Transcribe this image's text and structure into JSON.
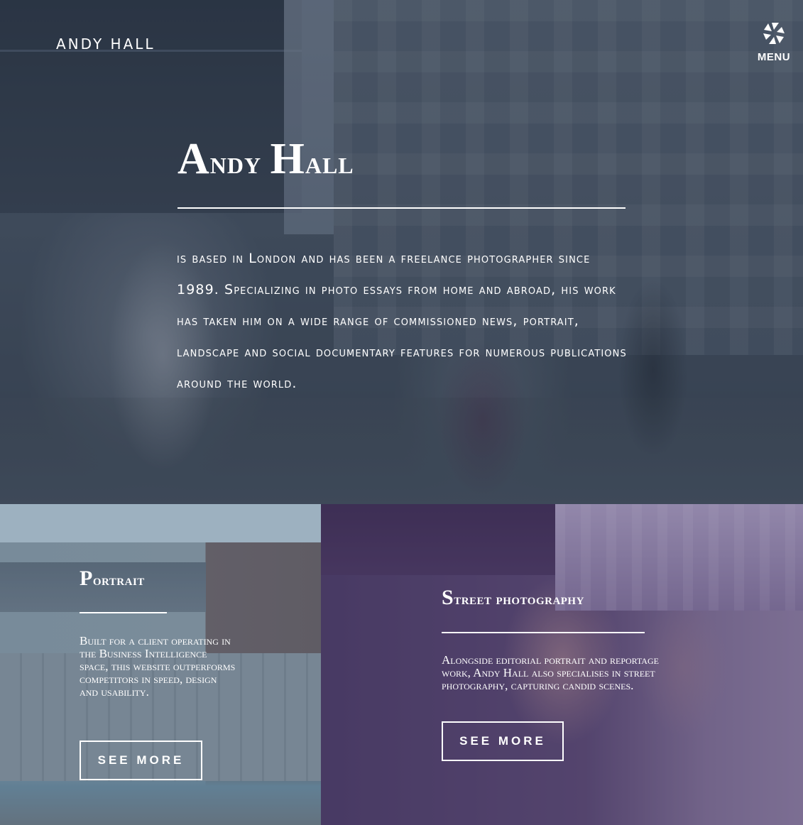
{
  "header": {
    "brand": "ANDY HALL",
    "menu_label": "MENU",
    "menu_icon": "aperture-icon"
  },
  "hero": {
    "title_initial_1": "A",
    "title_rest_1": "ndy ",
    "title_initial_2": "H",
    "title_rest_2": "all",
    "description": "is based in London and has been a freelance photographer since 1989. Specializing in photo essays from home and abroad, his work has taken him on a wide range of commissioned news, portrait, landscape and social documentary features for numerous publications around the world."
  },
  "cards": [
    {
      "title_initial": "P",
      "title_rest": "ortrait",
      "text": "Built for a client operating in the Business Intelligence space, this website outperforms competitors in speed, design and usability.",
      "button_label": "SEE MORE"
    },
    {
      "title_initial": "S",
      "title_rest": "treet photography",
      "text": "Alongside editorial portrait and reportage work, Andy Hall also specialises in street photography, capturing candid scenes.",
      "button_label": "SEE MORE"
    }
  ],
  "colors": {
    "text": "#ffffff",
    "hero_overlay": "#283444",
    "street_overlay": "#46326e"
  }
}
